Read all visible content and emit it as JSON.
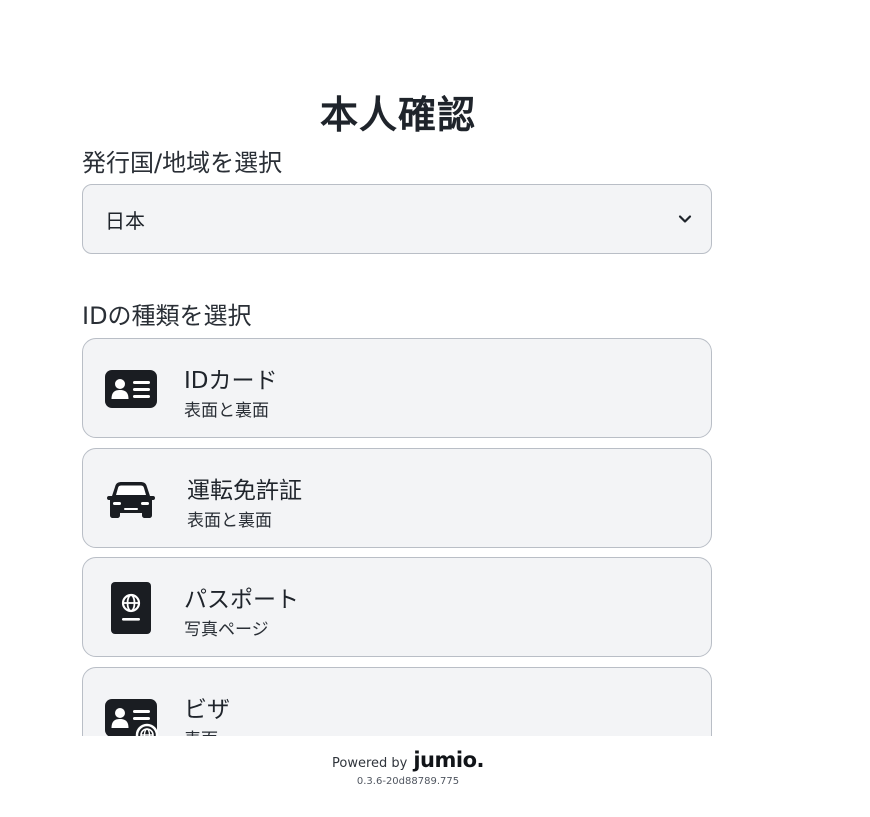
{
  "header": {
    "title": "本人確認"
  },
  "country": {
    "label": "発行国/地域を選択",
    "selected": "日本",
    "icon": "chevron-down-icon"
  },
  "id_type": {
    "label": "IDの種類を選択",
    "items": [
      {
        "title": "IDカード",
        "subtitle": "表面と裏面",
        "icon": "id-card-icon"
      },
      {
        "title": "運転免許証",
        "subtitle": "表面と裏面",
        "icon": "car-icon"
      },
      {
        "title": "パスポート",
        "subtitle": "写真ページ",
        "icon": "passport-icon"
      },
      {
        "title": "ビザ",
        "subtitle": "表面",
        "icon": "visa-card-icon"
      }
    ]
  },
  "footer": {
    "powered_by": "Powered by",
    "brand": "jumio.",
    "version": "0.3.6-20d88789.775"
  },
  "colors": {
    "text": "#1f242b",
    "card_bg": "#f3f4f6",
    "card_border": "#b9bec6",
    "icon": "#1a1d22"
  }
}
